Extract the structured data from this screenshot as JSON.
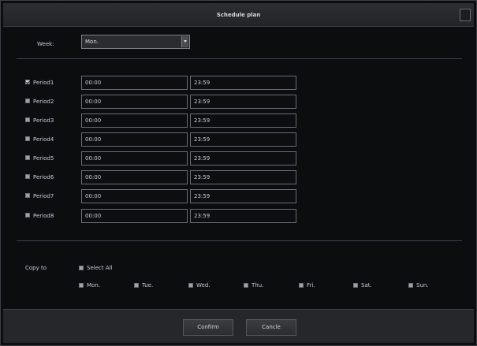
{
  "dialog": {
    "title": "Schedule plan"
  },
  "week": {
    "label": "Week",
    "selected": "Mon."
  },
  "periods": [
    {
      "label": "Period1",
      "checked": true,
      "start": "00:00",
      "end": "23:59"
    },
    {
      "label": "Period2",
      "checked": false,
      "start": "00:00",
      "end": "23:59"
    },
    {
      "label": "Period3",
      "checked": false,
      "start": "00:00",
      "end": "23:59"
    },
    {
      "label": "Period4",
      "checked": false,
      "start": "00:00",
      "end": "23:59"
    },
    {
      "label": "Period5",
      "checked": false,
      "start": "00:00",
      "end": "23:59"
    },
    {
      "label": "Period6",
      "checked": false,
      "start": "00:00",
      "end": "23:59"
    },
    {
      "label": "Period7",
      "checked": false,
      "start": "00:00",
      "end": "23:59"
    },
    {
      "label": "Period8",
      "checked": false,
      "start": "00:00",
      "end": "23:59"
    }
  ],
  "copy": {
    "label": "Copy to",
    "select_all": "Select All",
    "days": [
      "Mon.",
      "Tue.",
      "Wed.",
      "Thu.",
      "Fri.",
      "Sat.",
      "Sun."
    ]
  },
  "footer": {
    "confirm": "Confirm",
    "cancel": "Cancle"
  }
}
